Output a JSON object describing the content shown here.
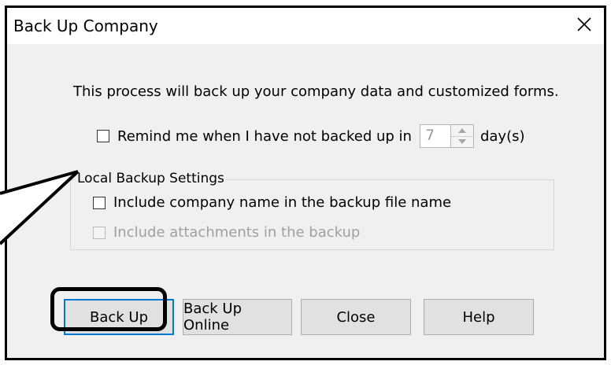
{
  "window": {
    "title": "Back Up Company",
    "close_glyph": "✕"
  },
  "intro_text": "This process will back up your company data and customized forms.",
  "reminder": {
    "label": "Remind me when I have not backed up in",
    "checked": false,
    "days_value": "7",
    "days_unit": "day(s)"
  },
  "local_backup": {
    "legend": "Local Backup Settings",
    "options": [
      {
        "label": "Include company name in the backup file name",
        "checked": false,
        "enabled": true
      },
      {
        "label": "Include attachments in the backup",
        "checked": false,
        "enabled": false
      }
    ]
  },
  "buttons": {
    "back_up": "Back Up",
    "back_up_online": "Back Up Online",
    "close": "Close",
    "help": "Help"
  },
  "colors": {
    "focus_border": "#0078d7",
    "dialog_bg": "#f0f0f0",
    "annotation": "#000000"
  }
}
